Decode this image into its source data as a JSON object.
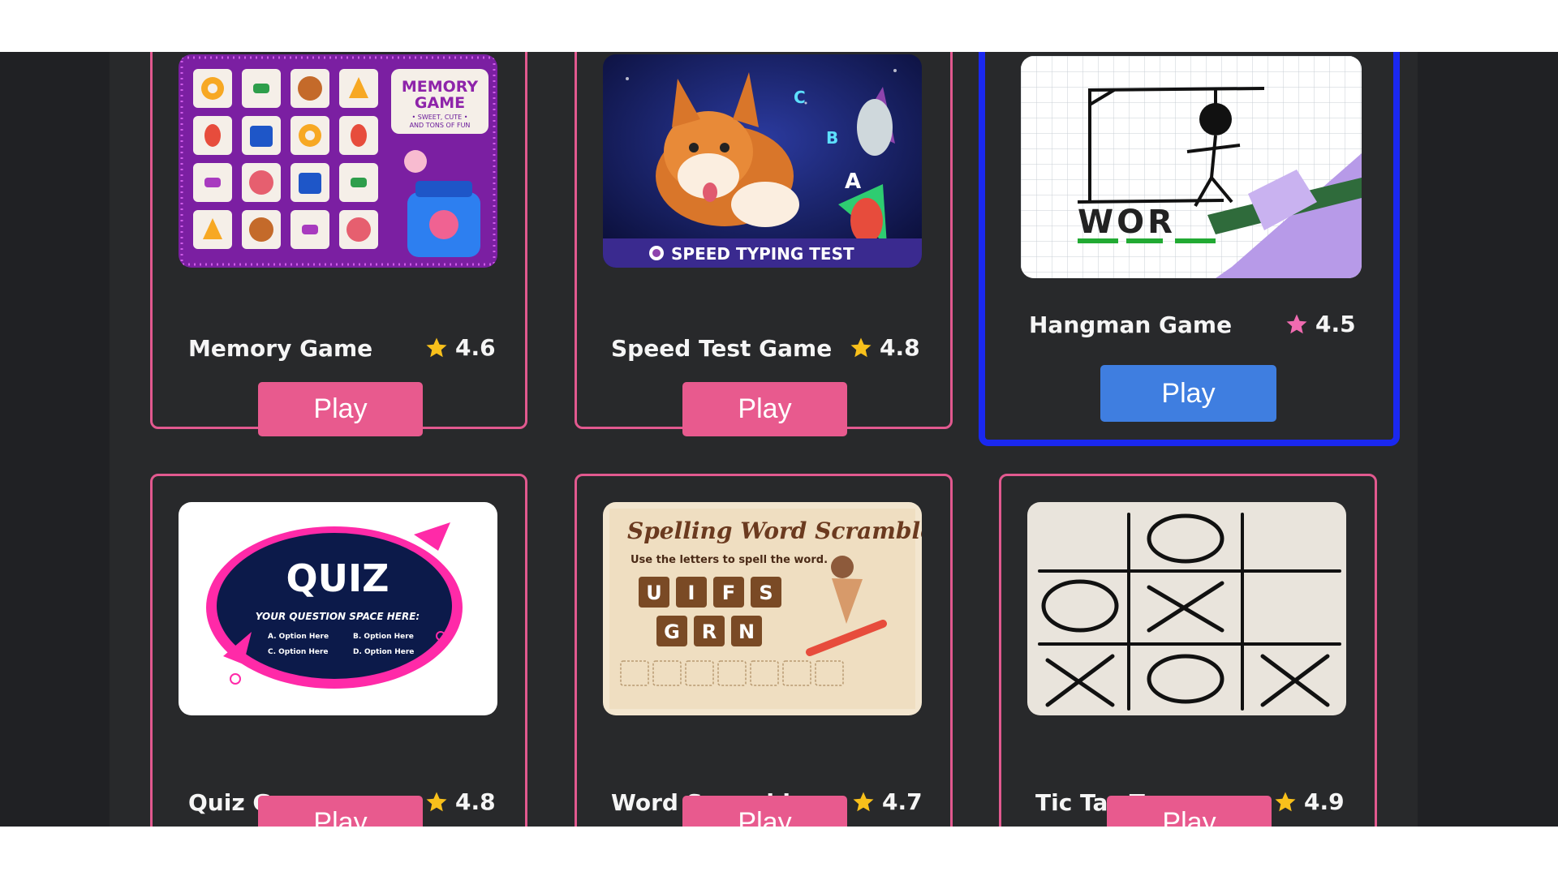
{
  "games": [
    {
      "title": "Memory Game",
      "rating": "4.6",
      "play_label": "Play",
      "thumb_text": [
        "MEMORY",
        "GAME",
        "• SWEET, CUTE •",
        "AND TONS OF FUN"
      ]
    },
    {
      "title": "Speed Test Game",
      "rating": "4.8",
      "play_label": "Play",
      "thumb_text": [
        "SPEED TYPING TEST"
      ]
    },
    {
      "title": "Hangman Game",
      "rating": "4.5",
      "play_label": "Play",
      "thumb_text": [
        "WOR"
      ]
    },
    {
      "title": "Quiz Game",
      "rating": "4.8",
      "play_label": "Play",
      "thumb_text": [
        "QUIZ",
        "YOUR QUESTION SPACE HERE:",
        "A.  Option Here",
        "B.  Option Here",
        "C.  Option Here",
        "D.  Option Here"
      ]
    },
    {
      "title": "Word Scramble",
      "rating": "4.7",
      "play_label": "Play",
      "thumb_text": [
        "Spelling Word Scramble",
        "Use the letters to spell the word.",
        "U",
        "I",
        "F",
        "S",
        "G",
        "R",
        "N"
      ]
    },
    {
      "title": "Tic Tac Toe",
      "rating": "4.9",
      "play_label": "Play",
      "thumb_text": []
    }
  ],
  "colors": {
    "card_border": "#e2598f",
    "play_button": "#e85a8e",
    "play_button_selected": "#3f7ee0",
    "selected_border": "#1a28f0",
    "star": "#f8c01b",
    "star_selected": "#f06bb0"
  },
  "icons": {
    "rating": "star-icon"
  }
}
